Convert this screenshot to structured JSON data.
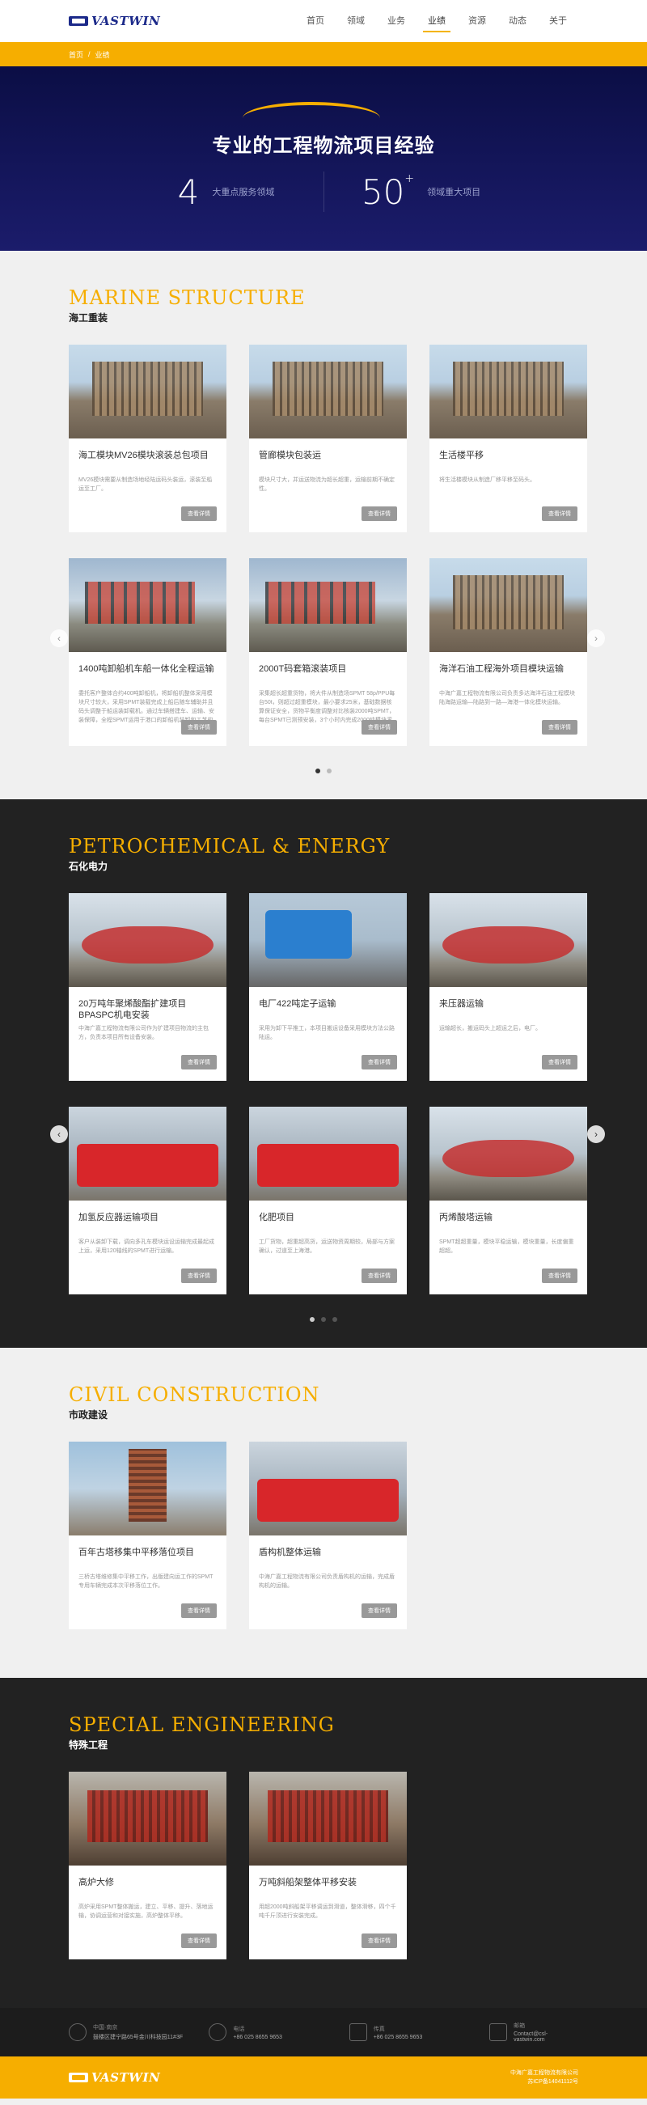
{
  "brand": {
    "name": "VASTWIN"
  },
  "nav": [
    {
      "label": "首页"
    },
    {
      "label": "领域"
    },
    {
      "label": "业务"
    },
    {
      "label": "业绩"
    },
    {
      "label": "资源"
    },
    {
      "label": "动态"
    },
    {
      "label": "关于"
    }
  ],
  "breadcrumb": {
    "home": "首页",
    "separator": "/",
    "current": "业绩"
  },
  "hero": {
    "title": "专业的工程物流项目经验",
    "stats": [
      {
        "num": "4",
        "sup": "",
        "label": "大重点服务领域"
      },
      {
        "num": "50",
        "sup": "+",
        "label": "领域重大项目"
      }
    ]
  },
  "more_label": "查看详情",
  "sections": [
    {
      "en": "MARINE STRUCTURE",
      "cn": "海工重装",
      "cards": [
        {
          "title": "海工模块MV26模块滚装总包项目",
          "desc": "MV26模块需要从制造场地经陆运码头装运，滚装至船运至工厂。"
        },
        {
          "title": "管廊模块包装运",
          "desc": "模块尺寸大，并运送物流为超长超重，运输前期不确定性。"
        },
        {
          "title": "生活楼平移",
          "desc": "将生活楼模块从制造厂移平移至码头。"
        },
        {
          "title": "1400吨卸船机车船一体化全程运输",
          "desc": "委托客户整体合约400吨卸船机，将卸船机整体采用模块尺寸较大，采用SPMT装载完成上船后随车辅助并且码头调整于船运装卸载机。通过车辆搭建车、运输、安装保障，全程SPMT运用于港口的卸船机装卸和工艺的示范性工程。"
        },
        {
          "title": "2000T码套箱滚装项目",
          "desc": "采集超长超重货物，将大件从制造场SPMT 58p/PPU每台50t，则超过超重模块，最小要求25米，基础数据核算保证安全，货物平衡度调整对比核装2000吨SPMT，每台SPMT已测预安装，3个小时内完成2000吨模块滚装。"
        },
        {
          "title": "海洋石油工程海外项目模块运输",
          "desc": "中海广嘉工程物流有限公司负责多达海洋石油工程模块陆海路运输—陆路到一路—海港一体化模块运输。"
        }
      ],
      "dots": [
        true,
        false
      ]
    },
    {
      "en": "PETROCHEMICAL & ENERGY",
      "cn": "石化电力",
      "cards": [
        {
          "title": "20万吨年聚烯酸酯扩建项目BPASPC机电安装",
          "desc": "中海广嘉工程物流有限公司作为扩建项目物流的主包方，负责本项目所有设备安装。"
        },
        {
          "title": "电厂422吨定子运输",
          "desc": "采用为卸下平推工，本项目搬运设备采用模块方法公路陆运。"
        },
        {
          "title": "来压器运输",
          "desc": "运输超长，搬运码头上超运之后，电厂。"
        },
        {
          "title": "加氢反应器运输项目",
          "desc": "客户从装卸下载，调向多孔车模块运设运输完成最起成上运，采用120轴线的SPMT进行运输。"
        },
        {
          "title": "化肥项目",
          "desc": "工厂货物，超重超高货，运送物资周期较，局部与方案确认，过道至上海港。"
        },
        {
          "title": "丙烯酸塔运输",
          "desc": "SPMT超超重量，模块平稳运输，模块重量，长度偏重超超。"
        }
      ],
      "dots": [
        true,
        false,
        false
      ]
    },
    {
      "en": "CIVIL CONSTRUCTION",
      "cn": "市政建设",
      "cards": [
        {
          "title": "百年古塔移集中平移落位项目",
          "desc": "三桥古塔维修集中平移工作，出版建向运工作的SPMT专用车辆完成本次平移落位工作。"
        },
        {
          "title": "盾构机整体运输",
          "desc": "中海广嘉工程物流有限公司负责盾构机的运输，完成盾构机的运输。"
        }
      ],
      "dots": []
    },
    {
      "en": "SPECIAL ENGINEERING",
      "cn": "特殊工程",
      "cards": [
        {
          "title": "高炉大修",
          "desc": "高炉采用SPMT整体搬运，建立、平移、提升、落地运输，协调运营和对接实施，高炉整体平移。"
        },
        {
          "title": "万吨斜船架整体平移安装",
          "desc": "用超2000吨斜船架平移调运到滑道，整体滑移，四个千吨千斤顶进行安装完成。"
        }
      ],
      "dots": []
    }
  ],
  "footer": {
    "items": [
      {
        "icon": "location-icon",
        "label": "中国·南京",
        "value": "鼓楼区建宁路65号金川科技园11#3F"
      },
      {
        "icon": "phone-icon",
        "label": "电话",
        "value": "+86 025 8655 9653"
      },
      {
        "icon": "fax-icon",
        "label": "传真",
        "value": "+86 025 8655 9653"
      },
      {
        "icon": "mail-icon",
        "label": "邮箱",
        "value": "Contact@csl-vastwin.com"
      }
    ],
    "copyright": "中海广嘉工程物流有限公司",
    "icp": "苏ICP备14041112号"
  }
}
